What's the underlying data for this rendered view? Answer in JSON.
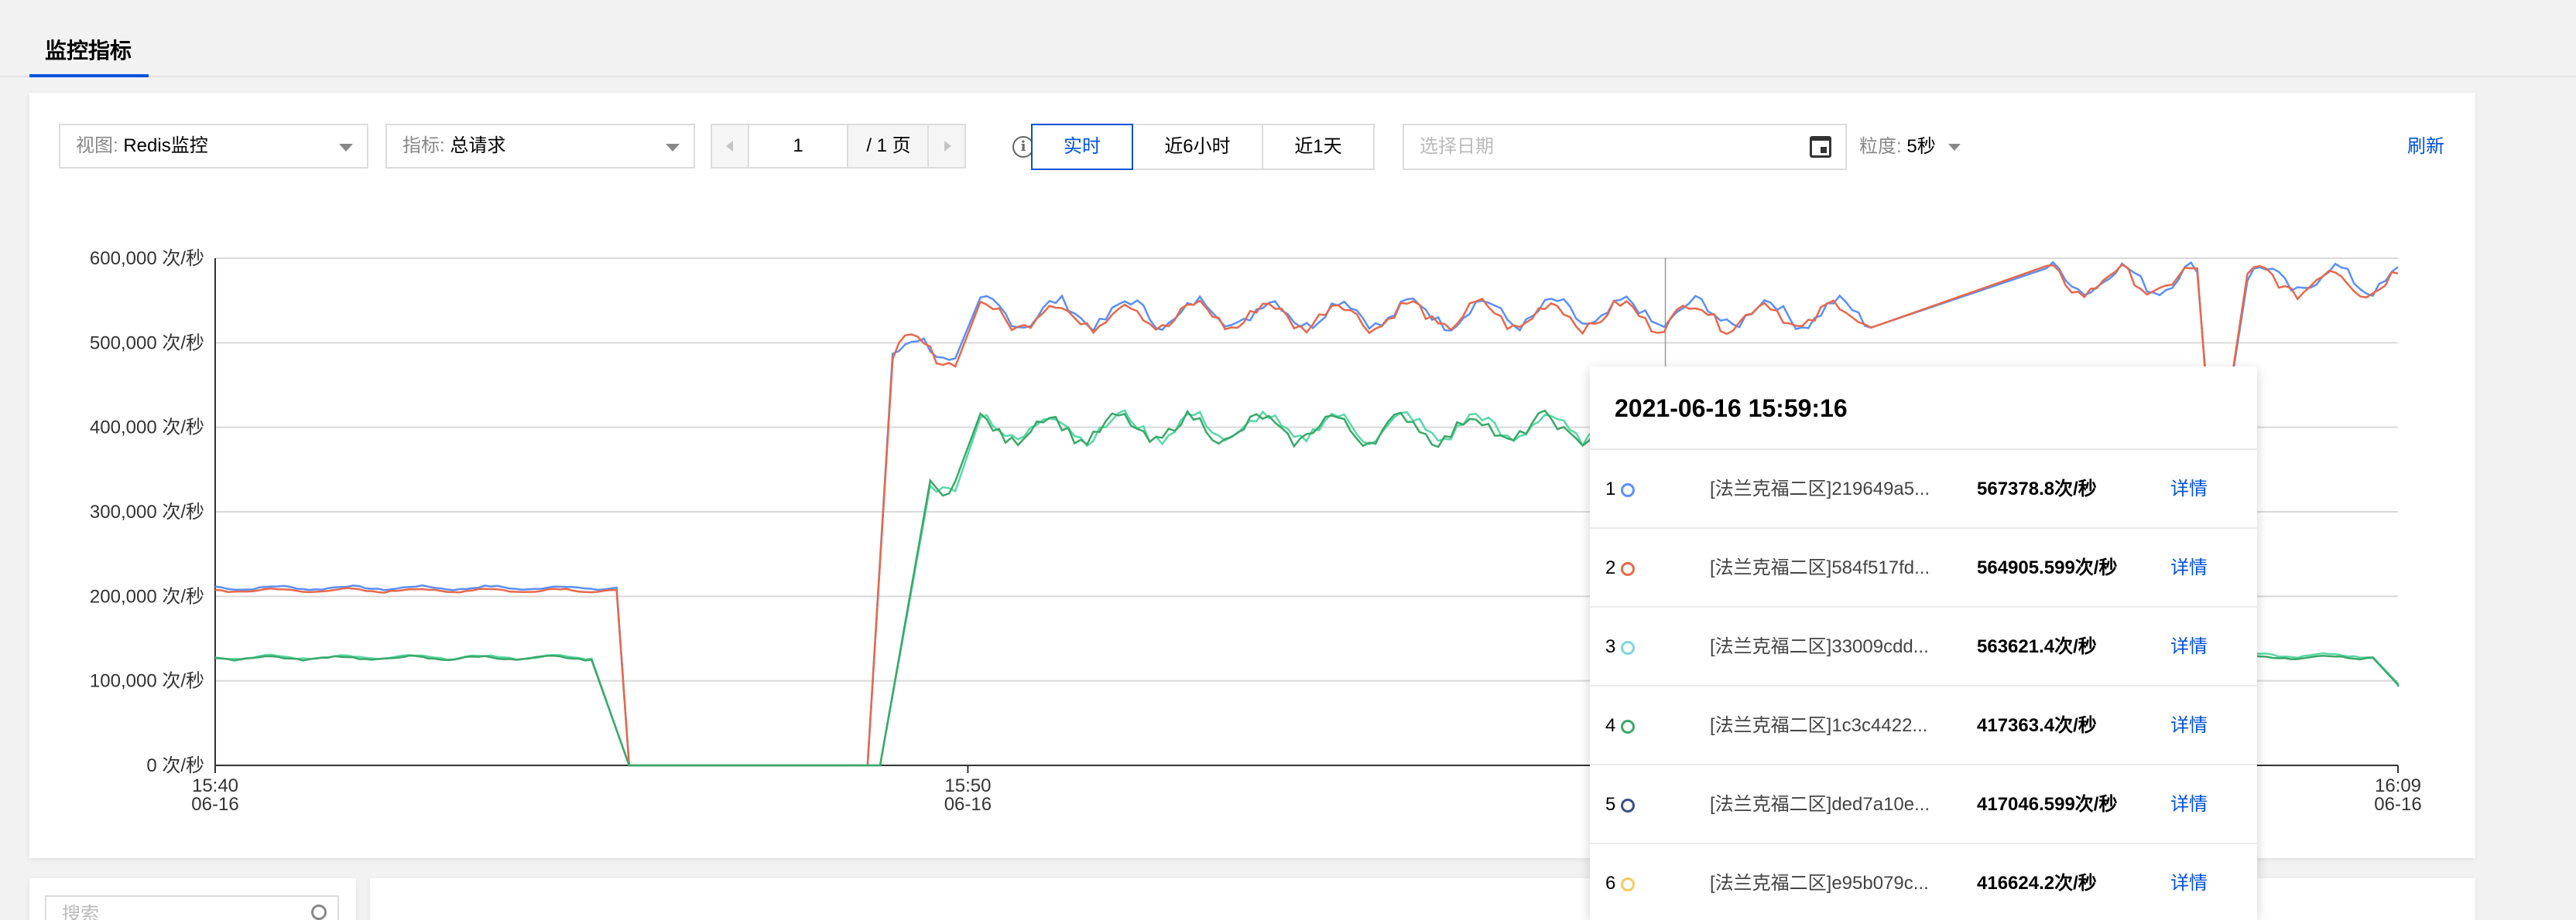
{
  "tabs": {
    "active": "监控指标"
  },
  "toolbar": {
    "view_label": "视图:",
    "view_value": "Redis监控",
    "metric_label": "指标:",
    "metric_value": "总请求",
    "page_current": "1",
    "page_total": "/ 1 页",
    "range_realtime": "实时",
    "range_6h": "近6小时",
    "range_1d": "近1天",
    "date_placeholder": "选择日期",
    "granularity_label": "粒度:",
    "granularity_value": "5秒",
    "refresh": "刷新"
  },
  "chart_data": {
    "type": "line",
    "y_ticks": [
      "600,000 次/秒",
      "500,000 次/秒",
      "400,000 次/秒",
      "300,000 次/秒",
      "200,000 次/秒",
      "100,000 次/秒",
      "0 次/秒"
    ],
    "x_ticks": [
      {
        "time": "15:40",
        "date": "06-16"
      },
      {
        "time": "15:50",
        "date": "06-16"
      },
      {
        "time": "16:09",
        "date": "06-16"
      }
    ],
    "ylim": [
      0,
      600000
    ],
    "x_range": [
      "15:40",
      "16:09"
    ],
    "grid": true,
    "hover_time": "15:59:16",
    "series": [
      {
        "color": "#5b8ff9",
        "segments": [
          {
            "from": "15:40:00",
            "to": "15:45:20",
            "value": 210000
          },
          {
            "from": "15:45:30",
            "to": "15:48:40",
            "value": 0
          },
          {
            "from": "15:49:00",
            "to": "15:49:50",
            "value": 490000
          },
          {
            "from": "15:50:10",
            "to": "16:02:00",
            "value": 535000
          },
          {
            "from": "16:04:20",
            "to": "16:06:20",
            "value": 575000
          },
          {
            "from": "16:06:30",
            "to": "16:06:40",
            "value": 400000
          },
          {
            "from": "16:07:00",
            "to": "16:09:00",
            "value": 575000
          }
        ]
      },
      {
        "color": "#e8684a",
        "segments": [
          {
            "from": "15:40:00",
            "to": "15:45:20",
            "value": 207000
          },
          {
            "from": "15:45:30",
            "to": "15:48:40",
            "value": 0
          },
          {
            "from": "15:49:00",
            "to": "15:49:50",
            "value": 490000
          },
          {
            "from": "15:50:10",
            "to": "16:02:00",
            "value": 532000
          },
          {
            "from": "16:04:20",
            "to": "16:06:20",
            "value": 572000
          },
          {
            "from": "16:06:30",
            "to": "16:06:40",
            "value": 395000
          },
          {
            "from": "16:07:00",
            "to": "16:09:00",
            "value": 572000
          }
        ]
      },
      {
        "color": "#5ad8a6",
        "segments": [
          {
            "from": "15:40:00",
            "to": "15:45:00",
            "value": 128000
          },
          {
            "from": "15:45:30",
            "to": "15:48:50",
            "value": 0
          },
          {
            "from": "15:49:30",
            "to": "15:49:50",
            "value": 340000
          },
          {
            "from": "15:50:10",
            "to": "15:59:00",
            "value": 400000
          },
          {
            "from": "16:04:20",
            "to": "16:06:20",
            "value": 345000
          },
          {
            "from": "16:06:40",
            "to": "16:08:40",
            "value": 130000
          },
          {
            "from": "16:09:00",
            "to": "16:09:00",
            "value": 95000
          }
        ]
      },
      {
        "color": "#3aa86a",
        "segments": [
          {
            "from": "15:40:00",
            "to": "15:45:00",
            "value": 127000
          },
          {
            "from": "15:45:30",
            "to": "15:48:50",
            "value": 0
          },
          {
            "from": "15:49:30",
            "to": "15:49:50",
            "value": 340000
          },
          {
            "from": "15:50:10",
            "to": "15:59:00",
            "value": 398000
          },
          {
            "from": "16:04:20",
            "to": "16:06:20",
            "value": 343000
          },
          {
            "from": "16:06:40",
            "to": "16:08:40",
            "value": 128000
          },
          {
            "from": "16:09:00",
            "to": "16:09:00",
            "value": 93000
          }
        ]
      }
    ]
  },
  "tooltip": {
    "title": "2021-06-16 15:59:16",
    "detail_label": "详情",
    "rows": [
      {
        "idx": "1",
        "color": "#5b8ff9",
        "name": "[法兰克福二区]219649a5...",
        "value": "567378.8次/秒"
      },
      {
        "idx": "2",
        "color": "#e8684a",
        "name": "[法兰克福二区]584f517fd...",
        "value": "564905.599次/秒"
      },
      {
        "idx": "3",
        "color": "#7fd6d6",
        "name": "[法兰克福二区]33009cdd...",
        "value": "563621.4次/秒"
      },
      {
        "idx": "4",
        "color": "#3aa86a",
        "name": "[法兰克福二区]1c3c4422...",
        "value": "417363.4次/秒"
      },
      {
        "idx": "5",
        "color": "#3d4f8a",
        "name": "[法兰克福二区]ded7a10e...",
        "value": "417046.599次/秒"
      },
      {
        "idx": "6",
        "color": "#f6c85f",
        "name": "[法兰克福二区]e95b079c...",
        "value": "416624.2次/秒"
      }
    ]
  },
  "bottom": {
    "search_placeholder": "搜索"
  }
}
